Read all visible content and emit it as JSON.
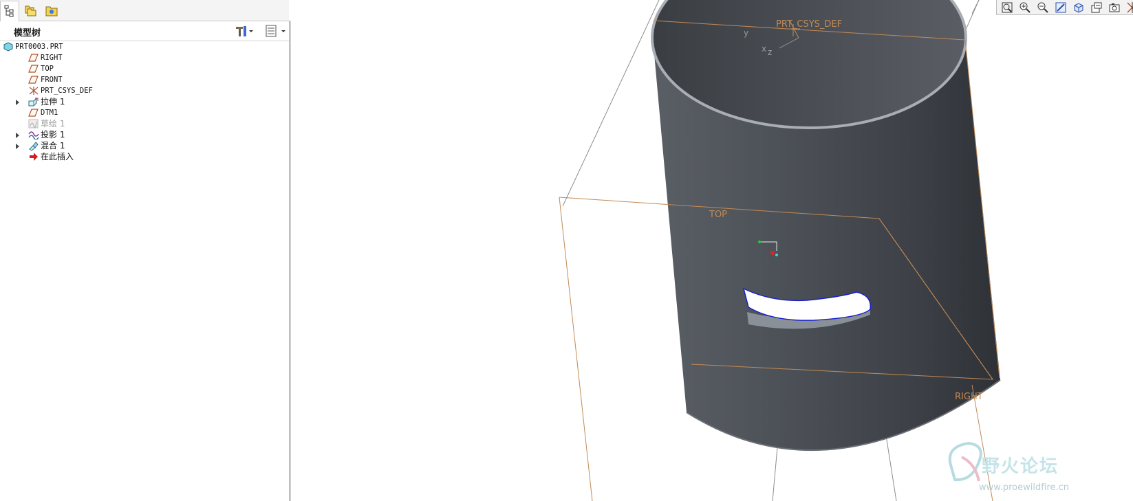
{
  "navigator": {
    "tabs": [
      {
        "name": "model-tree-tab",
        "icon": "model-tree-icon",
        "active": true
      },
      {
        "name": "folder-browser-tab",
        "icon": "folder-browser-icon",
        "active": false
      },
      {
        "name": "favorites-tab",
        "icon": "favorites-icon",
        "active": false
      }
    ]
  },
  "model_tree": {
    "title": "模型树",
    "settings_icon": "tools-icon",
    "show_icon": "tree-columns-icon",
    "items": [
      {
        "label": "PRT0003.PRT",
        "icon": "part-icon",
        "expandable": false,
        "indent": 0,
        "dim": false
      },
      {
        "label": "RIGHT",
        "icon": "datum-plane-icon",
        "expandable": false,
        "indent": 1,
        "dim": false
      },
      {
        "label": "TOP",
        "icon": "datum-plane-icon",
        "expandable": false,
        "indent": 1,
        "dim": false
      },
      {
        "label": "FRONT",
        "icon": "datum-plane-icon",
        "expandable": false,
        "indent": 1,
        "dim": false
      },
      {
        "label": "PRT_CSYS_DEF",
        "icon": "csys-icon",
        "expandable": false,
        "indent": 1,
        "dim": false
      },
      {
        "label": "拉伸 1",
        "icon": "extrude-icon",
        "expandable": true,
        "indent": 1,
        "dim": false
      },
      {
        "label": "DTM1",
        "icon": "datum-plane-icon",
        "expandable": false,
        "indent": 1,
        "dim": false
      },
      {
        "label": "草绘 1",
        "icon": "sketch-icon",
        "expandable": false,
        "indent": 1,
        "dim": true
      },
      {
        "label": "投影 1",
        "icon": "project-icon",
        "expandable": true,
        "indent": 1,
        "dim": false
      },
      {
        "label": "混合 1",
        "icon": "blend-icon",
        "expandable": true,
        "indent": 1,
        "dim": false
      },
      {
        "label": "在此插入",
        "icon": "insert-here-arrow-icon",
        "expandable": false,
        "indent": 1,
        "dim": false
      }
    ]
  },
  "view_toolbar": [
    {
      "name": "refit-button",
      "icon": "refit-icon"
    },
    {
      "name": "zoom-in-button",
      "icon": "zoom-in-icon"
    },
    {
      "name": "zoom-out-button",
      "icon": "zoom-out-icon"
    },
    {
      "name": "repaint-button",
      "icon": "repaint-icon"
    },
    {
      "name": "display-style-button",
      "icon": "shaded-cube-icon"
    },
    {
      "name": "saved-views-button",
      "icon": "saved-views-icon"
    },
    {
      "name": "view-manager-button",
      "icon": "camera-icon"
    },
    {
      "name": "datum-display-button",
      "icon": "datum-display-icon"
    },
    {
      "name": "annotation-display-button",
      "icon": "annotation-icon",
      "pressed": true
    },
    {
      "name": "spin-center-button",
      "icon": "spin-center-icon"
    }
  ],
  "viewport": {
    "labels": {
      "csys": "PRT_CSYS_DEF",
      "axis_y": "y",
      "axis_x": "x",
      "axis_z": "z",
      "top_plane": "TOP",
      "right_plane": "RIGHT"
    },
    "colors": {
      "datum": "#c28a55",
      "body": "#4a4f55",
      "slot_edge": "#1a22c8"
    }
  },
  "watermark": {
    "title": "野火论坛",
    "url": "www.proewildfire.cn"
  }
}
